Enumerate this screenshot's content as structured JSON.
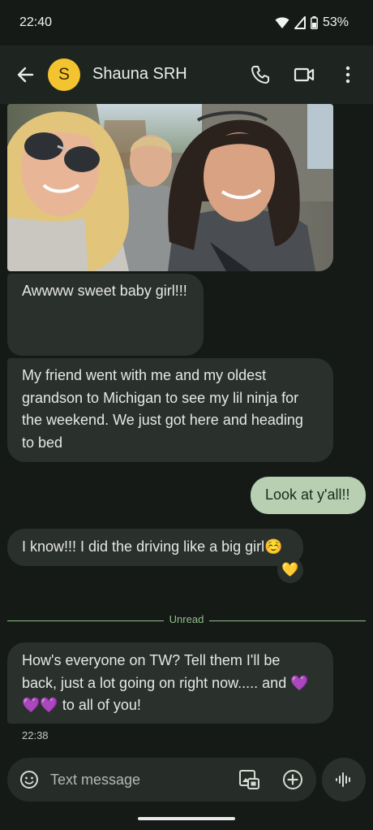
{
  "status_bar": {
    "time": "22:40",
    "battery": "53%"
  },
  "header": {
    "avatar_letter": "S",
    "contact_name": "Shauna SRH"
  },
  "messages": [
    {
      "direction": "incoming",
      "text": "Awwww sweet baby girl!!!"
    },
    {
      "direction": "incoming",
      "lines": [
        "My friend went with me and my oldest",
        "grandson to Michigan to see my lil ninja for",
        "the weekend. We just got here and heading",
        "to bed"
      ]
    },
    {
      "direction": "outgoing",
      "text": "Look at y'all!!"
    },
    {
      "direction": "incoming",
      "text": "I know!!! I did the driving like a big girl☺️",
      "reaction": "💛"
    },
    {
      "direction": "incoming",
      "lines": [
        "How's everyone on TW? Tell them I'll be",
        "back, just a lot going on right now..... and 💜",
        "💜💜 to all of you!"
      ],
      "time": "22:38"
    }
  ],
  "unread_label": "Unread",
  "compose": {
    "placeholder": "Text message"
  },
  "icons": [
    "back-arrow-icon",
    "phone-icon",
    "video-call-icon",
    "more-vert-icon",
    "emoji-icon",
    "gallery-icon",
    "add-icon",
    "voice-icon",
    "wifi-icon",
    "signal-icon",
    "battery-icon"
  ],
  "colors": {
    "background": "#151a17",
    "app_bar": "#1e2420",
    "incoming_bubble": "#2a302c",
    "outgoing_bubble": "#b9cfb2",
    "avatar": "#f4c430",
    "unread_accent": "#8fbf88"
  }
}
